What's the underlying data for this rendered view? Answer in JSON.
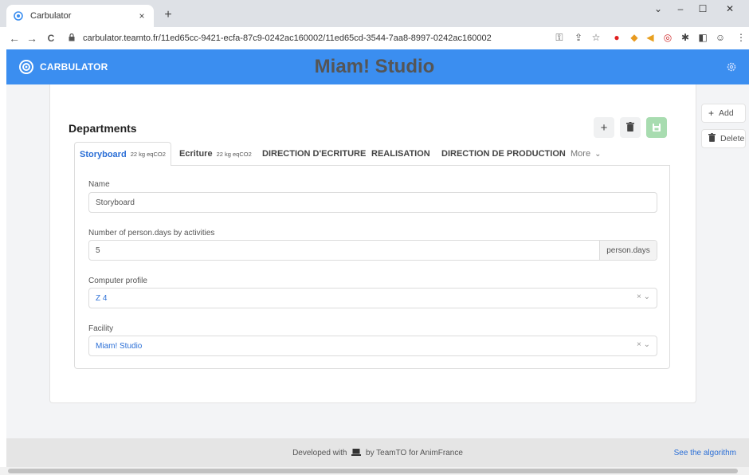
{
  "browser": {
    "tab_title": "Carbulator",
    "close_tab_glyph": "×",
    "new_tab_glyph": "+",
    "url": "carbulator.teamto.fr/11ed65cc-9421-ecfa-87c9-0242ac160002/11ed65cd-3544-7aa8-8997-0242ac160002",
    "window_controls": [
      "⌄",
      "–",
      "☐",
      "✕"
    ],
    "nav": {
      "back": "←",
      "forward": "→",
      "reload": "C"
    }
  },
  "header": {
    "brand": "CARBULATOR",
    "title": "Miam! Studio",
    "accent_color": "#3b8ef0"
  },
  "departments": {
    "title": "Departments",
    "actions": {
      "add": "+",
      "delete": "🗑",
      "save": "💾"
    },
    "tabs": [
      {
        "label": "Storyboard",
        "sub": "22 kg eqCO2",
        "active": true
      },
      {
        "label": "Ecriture",
        "sub": "22 kg eqCO2"
      },
      {
        "label": "DIRECTION D'ECRITURE"
      },
      {
        "label": "REALISATION"
      },
      {
        "label": "DIRECTION DE PRODUCTION"
      }
    ],
    "more_label": "More",
    "more_chevron": "⌄",
    "form": {
      "name_label": "Name",
      "name_value": "Storyboard",
      "persondays_label": "Number of person.days by activities",
      "persondays_value": "5",
      "persondays_unit": "person.days",
      "computer_label": "Computer profile",
      "computer_value": "Z 4",
      "facility_label": "Facility",
      "facility_value": "Miam! Studio",
      "select_controls": "× ⌄"
    }
  },
  "side_actions": {
    "add_icon": "+",
    "add_label": "Add",
    "delete_icon": "🗑",
    "delete_label": "Delete"
  },
  "footer": {
    "developed_prefix": "Developed with",
    "developed_suffix": "by TeamTO for AnimFrance",
    "algo_link": "See the algorithm"
  }
}
